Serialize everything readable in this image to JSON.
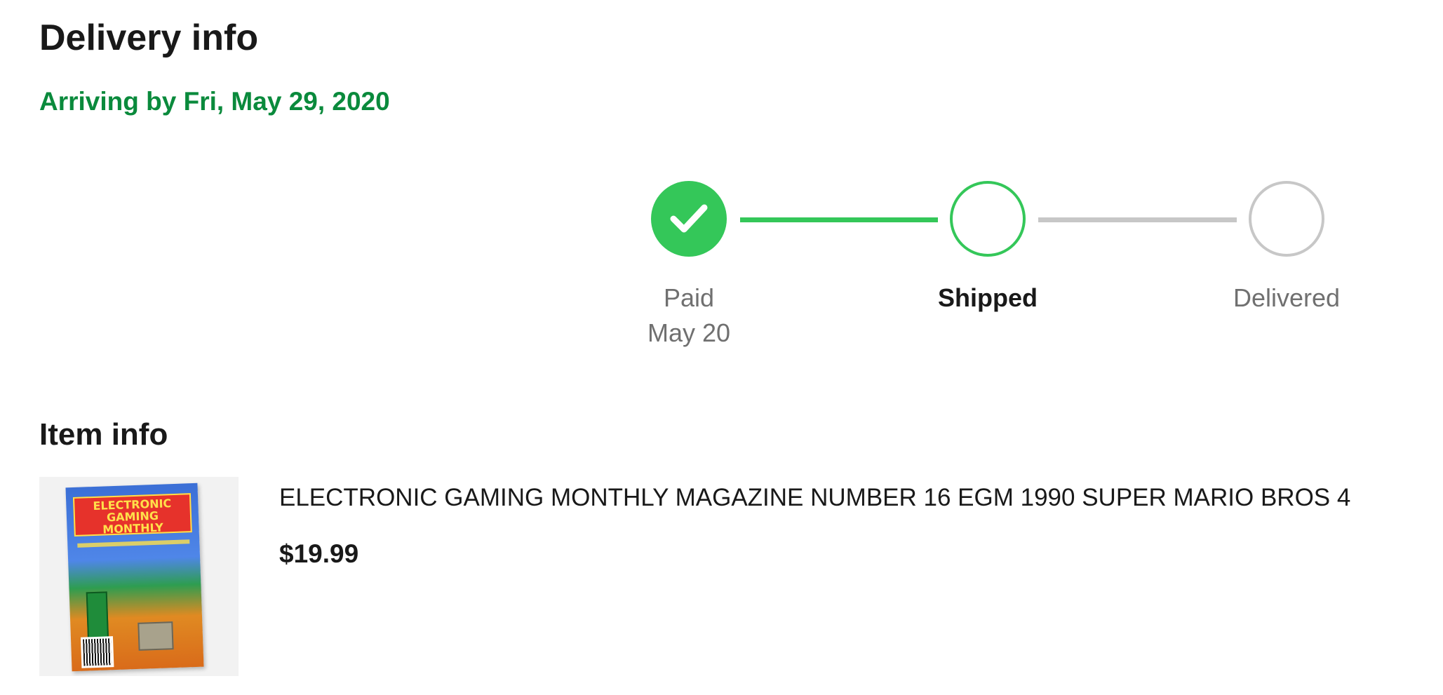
{
  "delivery": {
    "title": "Delivery info",
    "arrival": "Arriving by Fri, May 29, 2020",
    "accent_color": "#0a8a3c"
  },
  "tracker": {
    "colors": {
      "complete": "#34c759",
      "pending": "#c7c7c7"
    },
    "steps": [
      {
        "label": "Paid",
        "date": "May 20",
        "status": "complete",
        "icon": "checkmark-icon"
      },
      {
        "label": "Shipped",
        "date": "",
        "status": "current",
        "icon": ""
      },
      {
        "label": "Delivered",
        "date": "",
        "status": "pending",
        "icon": ""
      }
    ]
  },
  "item": {
    "section_title": "Item info",
    "title": "ELECTRONIC GAMING MONTHLY MAGAZINE NUMBER 16 EGM 1990 SUPER MARIO BROS 4",
    "price": "$19.99",
    "thumbnail_text": "ELECTRONIC GAMING MONTHLY"
  }
}
